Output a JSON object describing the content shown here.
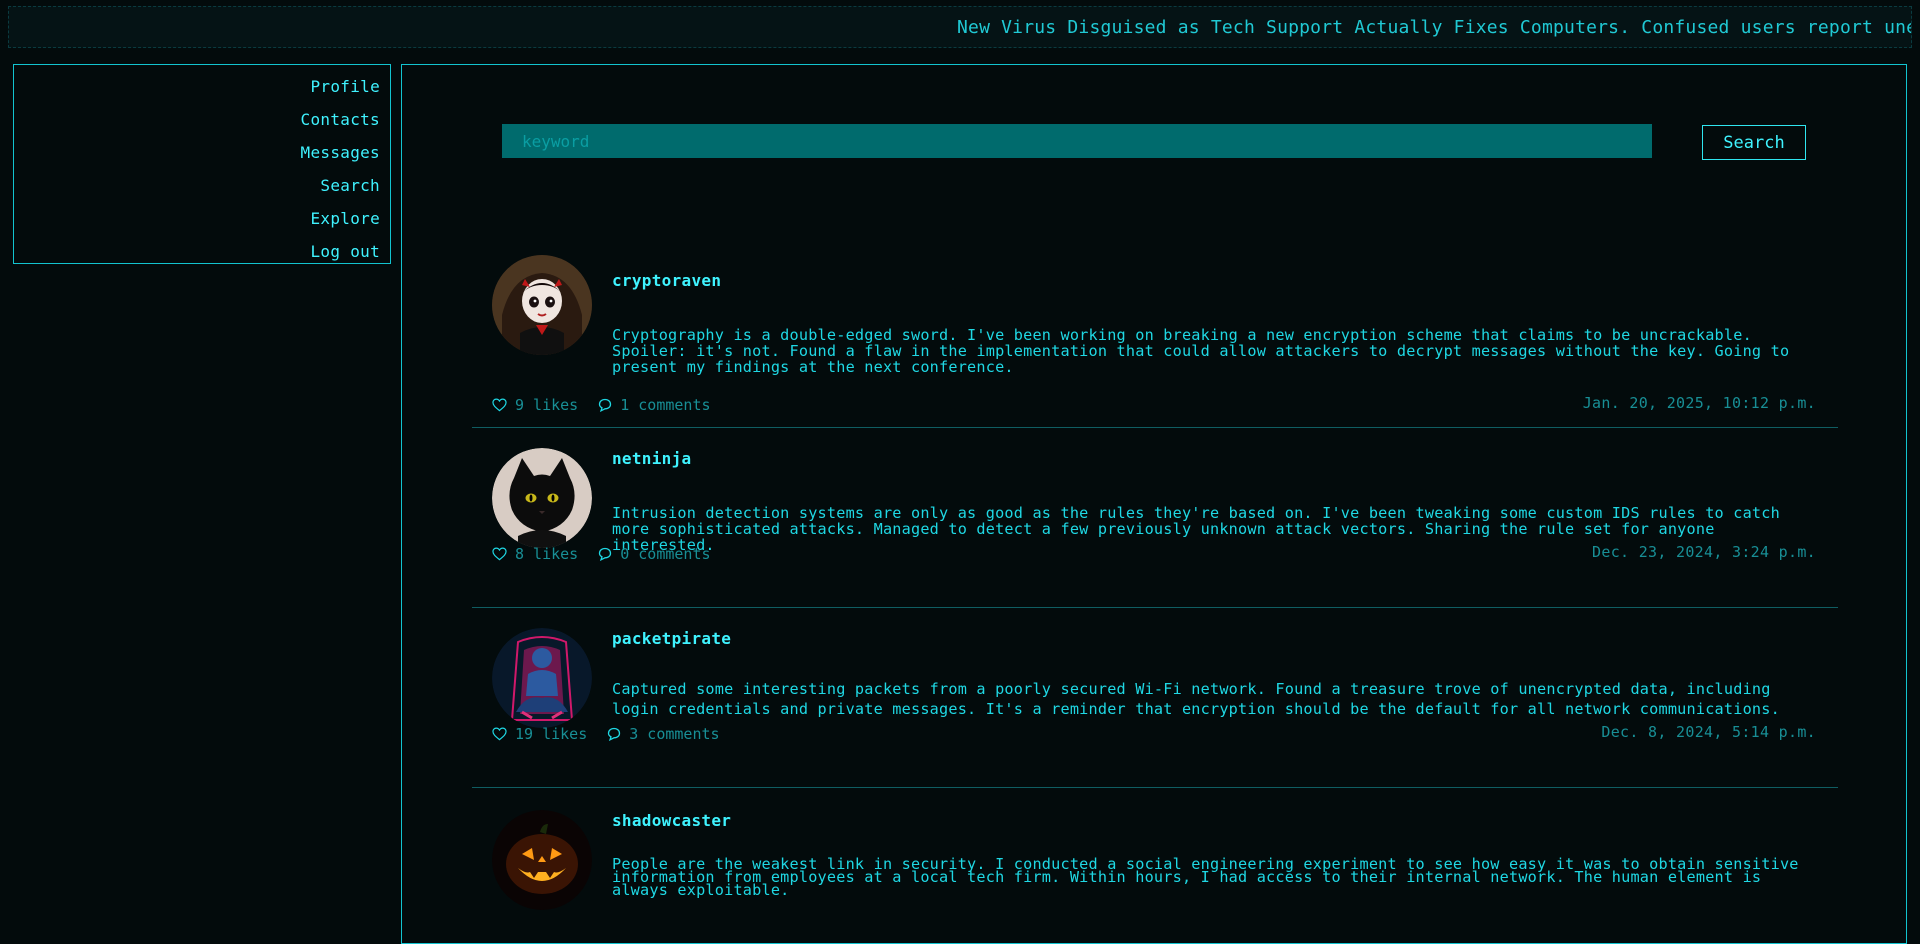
{
  "ticker": {
    "text": "New Virus Disguised as Tech Support Actually Fixes Computers. Confused users report unexpected"
  },
  "sidebar": {
    "items": [
      {
        "label": "Profile"
      },
      {
        "label": "Contacts"
      },
      {
        "label": "Messages"
      },
      {
        "label": "Search"
      },
      {
        "label": "Explore"
      },
      {
        "label": "Log out"
      }
    ]
  },
  "search": {
    "placeholder": "keyword",
    "value": "",
    "button_label": "Search"
  },
  "posts": [
    {
      "username": "cryptoraven",
      "content": "Cryptography is a double-edged sword. I've been working on breaking a new encryption scheme that claims to be uncrackable. Spoiler: it's not. Found a flaw in the implementation that could allow attackers to decrypt messages without the key. Going to present my findings at the next conference.",
      "likes": "9 likes",
      "comments": "1 comments",
      "timestamp": "Jan. 20, 2025, 10:12 p.m.",
      "avatar_icon": "doll-avatar-icon"
    },
    {
      "username": "netninja",
      "content": "Intrusion detection systems are only as good as the rules they're based on. I've been tweaking some custom IDS rules to catch more sophisticated attacks. Managed to detect a few previously unknown attack vectors. Sharing the rule set for anyone interested.",
      "likes": "8 likes",
      "comments": "0 comments",
      "timestamp": "Dec. 23, 2024, 3:24 p.m.",
      "avatar_icon": "black-cat-avatar-icon"
    },
    {
      "username": "packetpirate",
      "content": "Captured some interesting packets from a poorly secured Wi-Fi network. Found a treasure trove of unencrypted data, including login credentials and private messages. It's a reminder that encryption should be the default for all network communications.",
      "likes": "19 likes",
      "comments": "3 comments",
      "timestamp": "Dec. 8, 2024, 5:14 p.m.",
      "avatar_icon": "hacker-avatar-icon"
    },
    {
      "username": "shadowcaster",
      "content": "People are the weakest link in security. I conducted a social engineering experiment to see how easy it was to obtain sensitive information from employees at a local tech firm. Within hours, I had access to their internal network. The human element is always exploitable.",
      "likes": "",
      "comments": "",
      "timestamp": "",
      "avatar_icon": "jack-o-lantern-avatar-icon"
    }
  ],
  "colors": {
    "background": "#030b0c",
    "accent": "#3ff3ff",
    "border": "#12c4d0",
    "search_field": "#006b6d",
    "muted": "#188f96"
  }
}
